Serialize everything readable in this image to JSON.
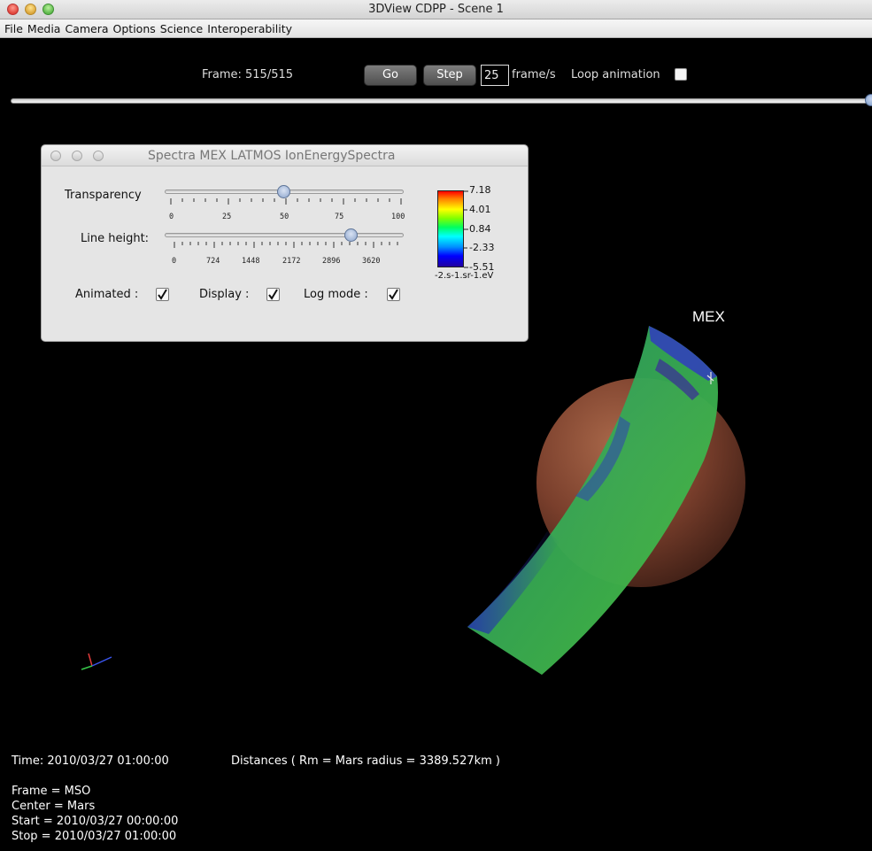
{
  "window": {
    "title": "3DView CDPP - Scene 1"
  },
  "menu": [
    "File",
    "Media",
    "Camera",
    "Options",
    "Science",
    "Interoperability"
  ],
  "controls": {
    "frame": "Frame: 515/515",
    "go": "Go",
    "step": "Step",
    "fps_value": "25",
    "fps_unit": "frame/s",
    "loop_label": "Loop animation",
    "loop_checked": false,
    "timeline_position": 1.0
  },
  "panel": {
    "title": "Spectra MEX LATMOS  IonEnergySpectra",
    "transparency_label": "Transparency",
    "transparency_ticks": [
      "0",
      "25",
      "50",
      "75",
      "100"
    ],
    "transparency_value": 50,
    "line_height_label": "Line height:",
    "line_height_ticks": [
      "0",
      "724",
      "1448",
      "2172",
      "2896",
      "3620"
    ],
    "line_height_value": 0.78,
    "animated_label": "Animated :",
    "display_label": "Display :",
    "log_mode_label": "Log mode :",
    "animated_checked": true,
    "display_checked": true,
    "log_mode_checked": true,
    "colorbar_ticks": [
      "7.18",
      "4.01",
      "0.84",
      "-2.33",
      "-5.51"
    ],
    "colorbar_unit": "-2.s-1.sr-1.eV"
  },
  "scene": {
    "spacecraft_label": "MEX"
  },
  "info": {
    "time": "Time: 2010/03/27 01:00:00",
    "distances": "Distances ( Rm = Mars radius = 3389.527km )",
    "frame": "Frame = MSO",
    "center": "Center = Mars",
    "start": "Start = 2010/03/27 00:00:00",
    "stop": "Stop = 2010/03/27 01:00:00"
  },
  "colors": {
    "background": "#000000",
    "mars": "#8a4b34",
    "spectra_green": "#2fa845",
    "spectra_blue": "#2a3cc0"
  },
  "icons": [
    "close-icon",
    "minimize-icon",
    "zoom-icon",
    "checkmark-icon",
    "axis-triad-icon"
  ]
}
